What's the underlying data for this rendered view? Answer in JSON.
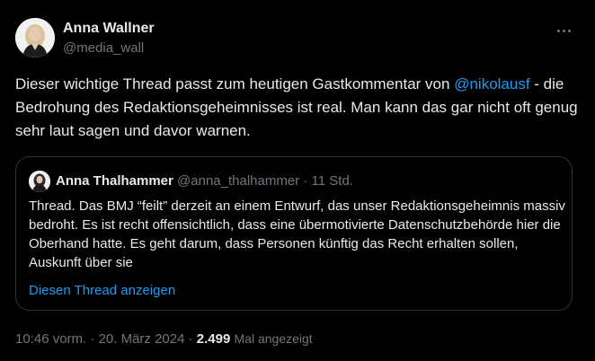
{
  "tweet": {
    "author": {
      "name": "Anna Wallner",
      "handle": "@media_wall"
    },
    "text_before": "Dieser wichtige Thread passt zum heutigen Gastkommentar von ",
    "mention": "@nikolausf",
    "text_after": " - die Bedrohung des Redaktionsgeheimnisses ist real. Man kann das gar nicht oft genug sehr laut sagen und davor warnen.",
    "more_icon": "more-horizontal-icon"
  },
  "quote": {
    "author_name": "Anna Thalhammer",
    "author_handle": "@anna_thalhammer",
    "separator": " · ",
    "time": "11 Std.",
    "text": "Thread. Das BMJ “feilt” derzeit an einem Entwurf, das unser Redaktionsgeheimnis massiv bedroht. Es ist recht offensichtlich, dass eine übermotivierte Datenschutzbehörde hier die Oberhand hatte. Es geht darum, dass Personen künftig das Recht erhalten sollen, Auskunft über sie",
    "show_thread": "Diesen Thread anzeigen"
  },
  "footer": {
    "time": "10:46 vorm.",
    "dot": " · ",
    "date": "20. März 2024",
    "views_count": "2.499",
    "views_label": "Mal angezeigt"
  },
  "colors": {
    "background": "#000000",
    "text": "#e7e9ea",
    "muted": "#71767b",
    "link": "#1d9bf0",
    "border": "#2f3336"
  }
}
